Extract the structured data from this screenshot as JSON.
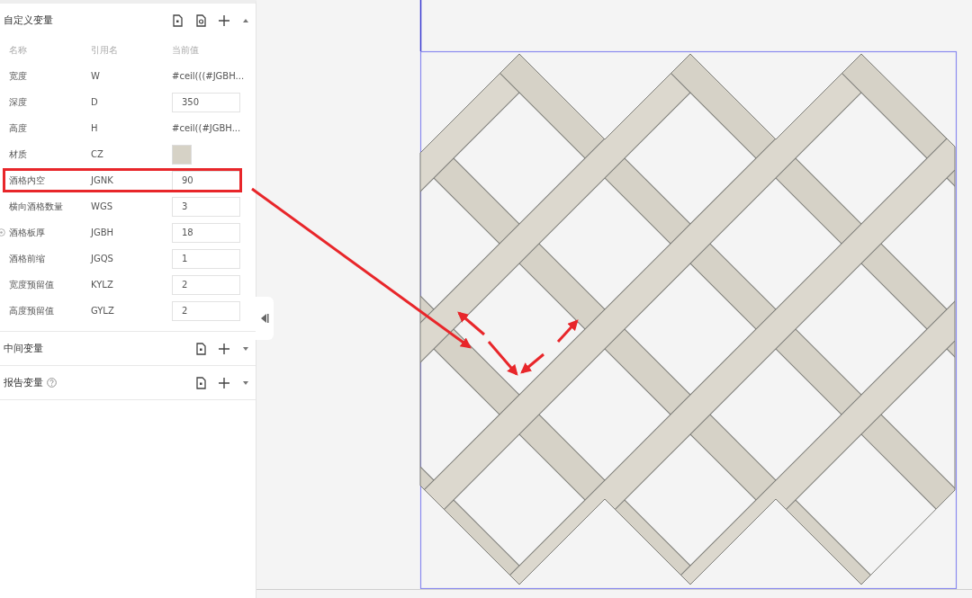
{
  "panels": [
    {
      "title": "自定义变量",
      "expanded": true,
      "actions": [
        {
          "kind": "import"
        },
        {
          "kind": "export"
        },
        {
          "kind": "add"
        }
      ],
      "columns": [
        "名称",
        "引用名",
        "当前值"
      ],
      "rows": [
        {
          "name": "宽度",
          "ref": "W",
          "kind": "text",
          "value": "#ceil(((#JGBH...",
          "highlighted": false,
          "marker": false
        },
        {
          "name": "深度",
          "ref": "D",
          "kind": "input",
          "value": "350",
          "highlighted": false,
          "marker": false
        },
        {
          "name": "高度",
          "ref": "H",
          "kind": "text",
          "value": "#ceil((#JGBH...",
          "highlighted": false,
          "marker": false
        },
        {
          "name": "材质",
          "ref": "CZ",
          "kind": "swatch",
          "color": "#d6d2c6",
          "highlighted": false,
          "marker": false
        },
        {
          "name": "酒格内空",
          "ref": "JGNK",
          "kind": "input",
          "value": "90",
          "highlighted": true,
          "marker": false
        },
        {
          "name": "横向酒格数量",
          "ref": "WGS",
          "kind": "input",
          "value": "3",
          "highlighted": false,
          "marker": false
        },
        {
          "name": "酒格板厚",
          "ref": "JGBH",
          "kind": "input",
          "value": "18",
          "highlighted": false,
          "marker": true
        },
        {
          "name": "酒格前缩",
          "ref": "JGQS",
          "kind": "input",
          "value": "1",
          "highlighted": false,
          "marker": false
        },
        {
          "name": "宽度预留值",
          "ref": "KYLZ",
          "kind": "input",
          "value": "2",
          "highlighted": false,
          "marker": false
        },
        {
          "name": "高度预留值",
          "ref": "GYLZ",
          "kind": "input",
          "value": "2",
          "highlighted": false,
          "marker": false
        }
      ]
    },
    {
      "title": "中间变量",
      "expanded": false,
      "actions": [
        {
          "kind": "import"
        },
        {
          "kind": "add"
        }
      ]
    },
    {
      "title": "报告变量",
      "help": true,
      "expanded": false,
      "actions": [
        {
          "kind": "import"
        },
        {
          "kind": "add"
        }
      ]
    }
  ]
}
